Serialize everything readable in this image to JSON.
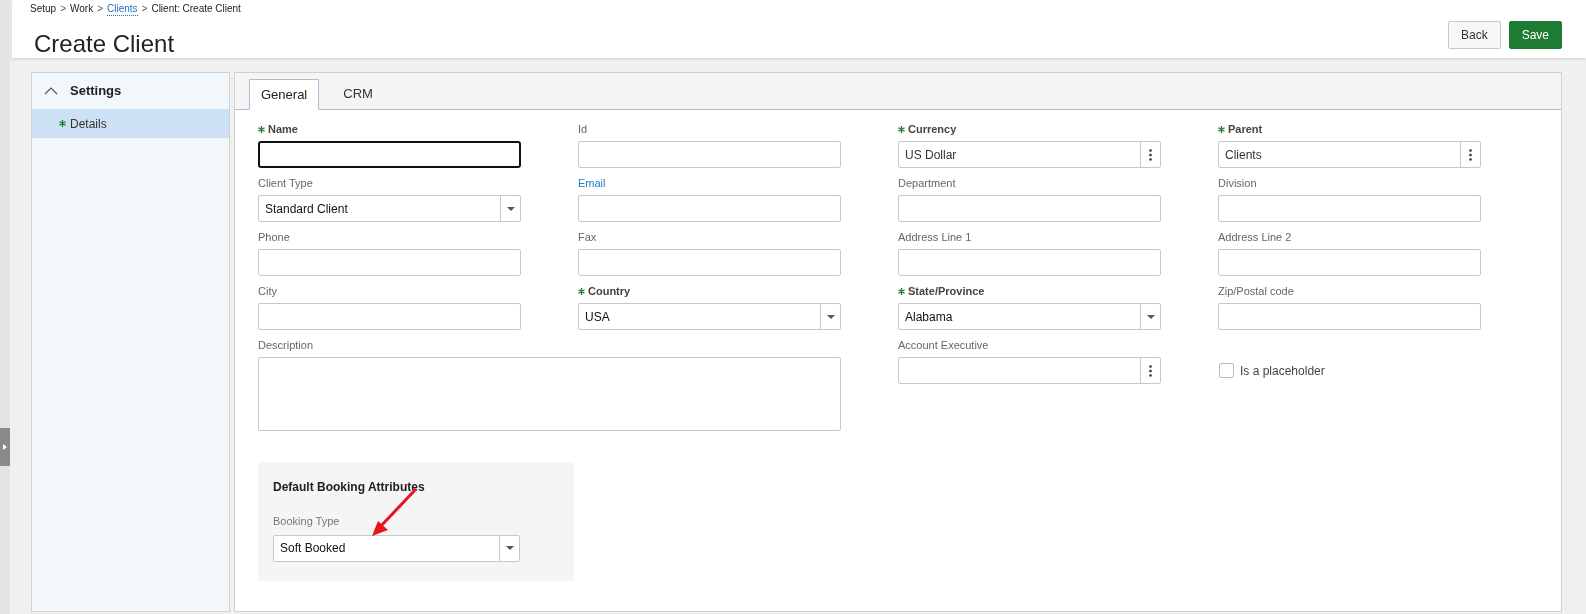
{
  "breadcrumb": [
    {
      "kind": "item",
      "label": "Setup",
      "link": false
    },
    {
      "kind": "separator",
      "label": ">",
      "link": false
    },
    {
      "kind": "item",
      "label": "Work",
      "link": false
    },
    {
      "kind": "separator",
      "label": ">",
      "link": false
    },
    {
      "kind": "item",
      "label": "Clients",
      "link": true
    },
    {
      "kind": "separator",
      "label": ">",
      "link": false
    },
    {
      "kind": "item",
      "label": "Client: Create Client",
      "link": false
    }
  ],
  "title": "Create Client",
  "header_buttons": [
    {
      "label": "Back",
      "kind": "secondary"
    },
    {
      "label": "Save",
      "kind": "primary"
    }
  ],
  "sidebar": {
    "group": {
      "label": "Settings",
      "expanded": true
    },
    "items": [
      {
        "label": "Details",
        "required": true,
        "selected": true
      }
    ]
  },
  "tabs": [
    {
      "label": "General",
      "selected": true
    },
    {
      "label": "CRM",
      "selected": false
    }
  ],
  "fields": [
    {
      "label": "Name",
      "required": true,
      "link": false,
      "kind": "text",
      "focused": true
    },
    {
      "label": "Id",
      "required": false,
      "link": false,
      "kind": "text",
      "focused": false
    },
    {
      "label": "Currency",
      "required": true,
      "link": false,
      "kind": "lookup",
      "value": "US Dollar",
      "focused": false
    },
    {
      "label": "Parent",
      "required": true,
      "link": false,
      "kind": "lookup",
      "value": "Clients",
      "focused": false
    },
    {
      "label": "Client Type",
      "required": false,
      "link": false,
      "kind": "select",
      "value": "Standard Client",
      "focused": false
    },
    {
      "label": "Email",
      "required": false,
      "link": true,
      "kind": "text",
      "focused": false
    },
    {
      "label": "Department",
      "required": false,
      "link": false,
      "kind": "text",
      "focused": false
    },
    {
      "label": "Division",
      "required": false,
      "link": false,
      "kind": "text",
      "focused": false
    },
    {
      "label": "Phone",
      "required": false,
      "link": false,
      "kind": "text",
      "focused": false
    },
    {
      "label": "Fax",
      "required": false,
      "link": false,
      "kind": "text",
      "focused": false
    },
    {
      "label": "Address Line 1",
      "required": false,
      "link": false,
      "kind": "text",
      "focused": false
    },
    {
      "label": "Address Line 2",
      "required": false,
      "link": false,
      "kind": "text",
      "focused": false
    },
    {
      "label": "City",
      "required": false,
      "link": false,
      "kind": "text",
      "focused": false
    },
    {
      "label": "Country",
      "required": true,
      "link": false,
      "kind": "select",
      "value": "USA",
      "focused": false
    },
    {
      "label": "State/Province",
      "required": true,
      "link": false,
      "kind": "select",
      "value": "Alabama",
      "focused": false
    },
    {
      "label": "Zip/Postal code",
      "required": false,
      "link": false,
      "kind": "text",
      "focused": false
    },
    {
      "label": "Description",
      "required": false,
      "link": false,
      "kind": "textarea",
      "focused": false
    },
    {
      "label": "Account Executive",
      "required": false,
      "link": false,
      "kind": "lookup",
      "focused": false
    },
    {
      "label": "Is a placeholder",
      "kind": "checkbox",
      "checked": false
    }
  ],
  "booking": {
    "title": "Default Booking Attributes",
    "field": {
      "label": "Booking Type",
      "kind": "select",
      "value": "Soft Booked"
    }
  }
}
